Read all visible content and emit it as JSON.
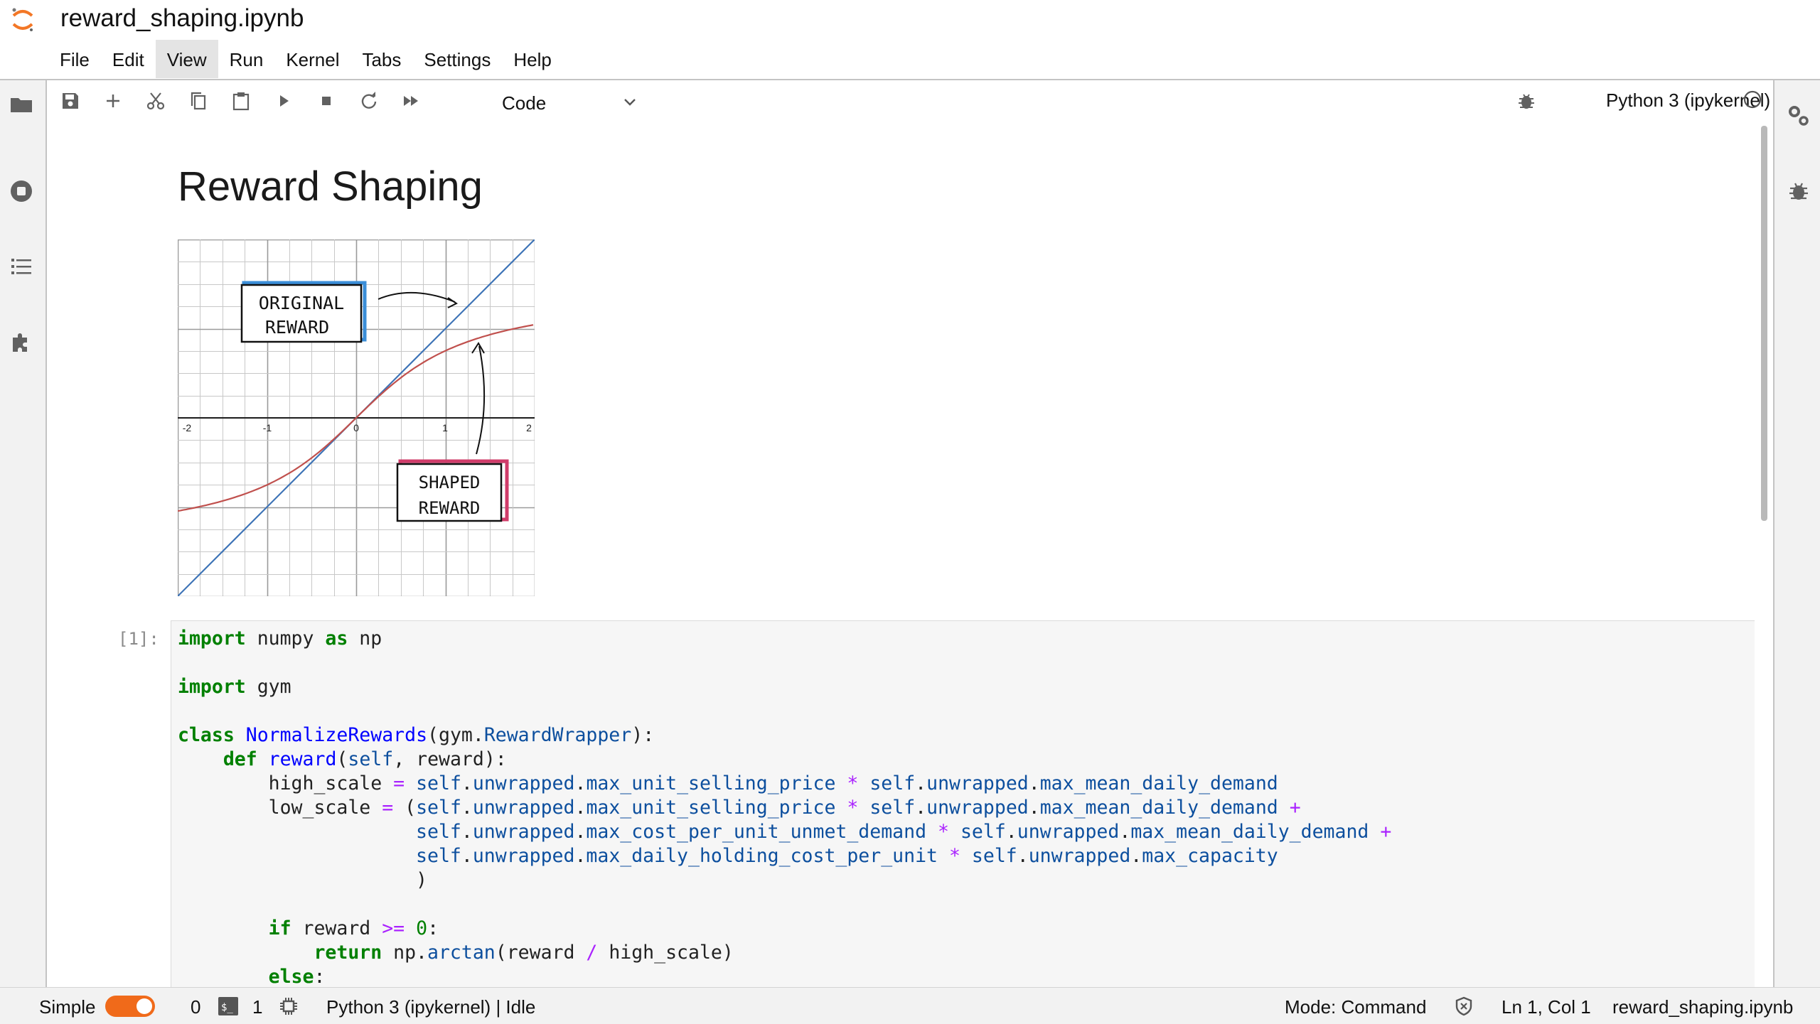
{
  "app": {
    "notebook_title": "reward_shaping.ipynb",
    "logo": "jupyter-logo"
  },
  "menu": {
    "items": [
      "File",
      "Edit",
      "View",
      "Run",
      "Kernel",
      "Tabs",
      "Settings",
      "Help"
    ],
    "active": "View"
  },
  "left_sidebar": {
    "icons": [
      "folder-icon",
      "running-terminals-icon",
      "table-of-contents-icon",
      "extensions-icon"
    ]
  },
  "right_sidebar": {
    "icons": [
      "property-inspector-icon",
      "debugger-icon"
    ]
  },
  "toolbar": {
    "buttons": [
      "save-icon",
      "add-cell-icon",
      "cut-icon",
      "copy-icon",
      "paste-icon",
      "run-icon",
      "stop-icon",
      "restart-icon",
      "run-all-icon"
    ],
    "cell_type": "Code",
    "kernel_name": "Python 3 (ipykernel)",
    "kernel_status": "idle"
  },
  "cells": {
    "markdown": {
      "heading": "Reward Shaping",
      "diagram": {
        "x_ticks": [
          "-2",
          "-1",
          "0",
          "1",
          "2"
        ],
        "box_original_line1": "ORIGINAL",
        "box_original_line2": "REWARD",
        "box_shaped_line1": "SHAPED",
        "box_shaped_line2": "REWARD",
        "original_color": "#3e74b7",
        "shaped_color": "#c0504d",
        "original_box_accent": "#3b8ed8",
        "shaped_box_accent": "#d03c6a"
      }
    },
    "code": {
      "prompt": "[1]:",
      "lines": [
        "import numpy as np",
        "",
        "import gym",
        "",
        "class NormalizeRewards(gym.RewardWrapper):",
        "    def reward(self, reward):",
        "        high_scale = self.unwrapped.max_unit_selling_price * self.unwrapped.max_mean_daily_demand",
        "        low_scale = (self.unwrapped.max_unit_selling_price * self.unwrapped.max_mean_daily_demand +",
        "                     self.unwrapped.max_cost_per_unit_unmet_demand * self.unwrapped.max_mean_daily_demand +",
        "                     self.unwrapped.max_daily_holding_cost_per_unit * self.unwrapped.max_capacity",
        "                     )",
        "",
        "        if reward >= 0:",
        "            return np.arctan(reward / high_scale)",
        "        else:"
      ]
    }
  },
  "statusbar": {
    "mode_label": "Simple",
    "simple_mode_on": true,
    "terminals_count": "0",
    "kernels_count": "1",
    "kernel_status": "Python 3 (ipykernel) | Idle",
    "mode": "Mode: Command",
    "cursor": "Ln 1, Col 1",
    "filename": "reward_shaping.ipynb"
  },
  "colors": {
    "accent": "#f37726",
    "toggle": "#f06a1a",
    "keyword": "#008000",
    "operator": "#aa22ff",
    "attribute": "#0d4f9e"
  }
}
